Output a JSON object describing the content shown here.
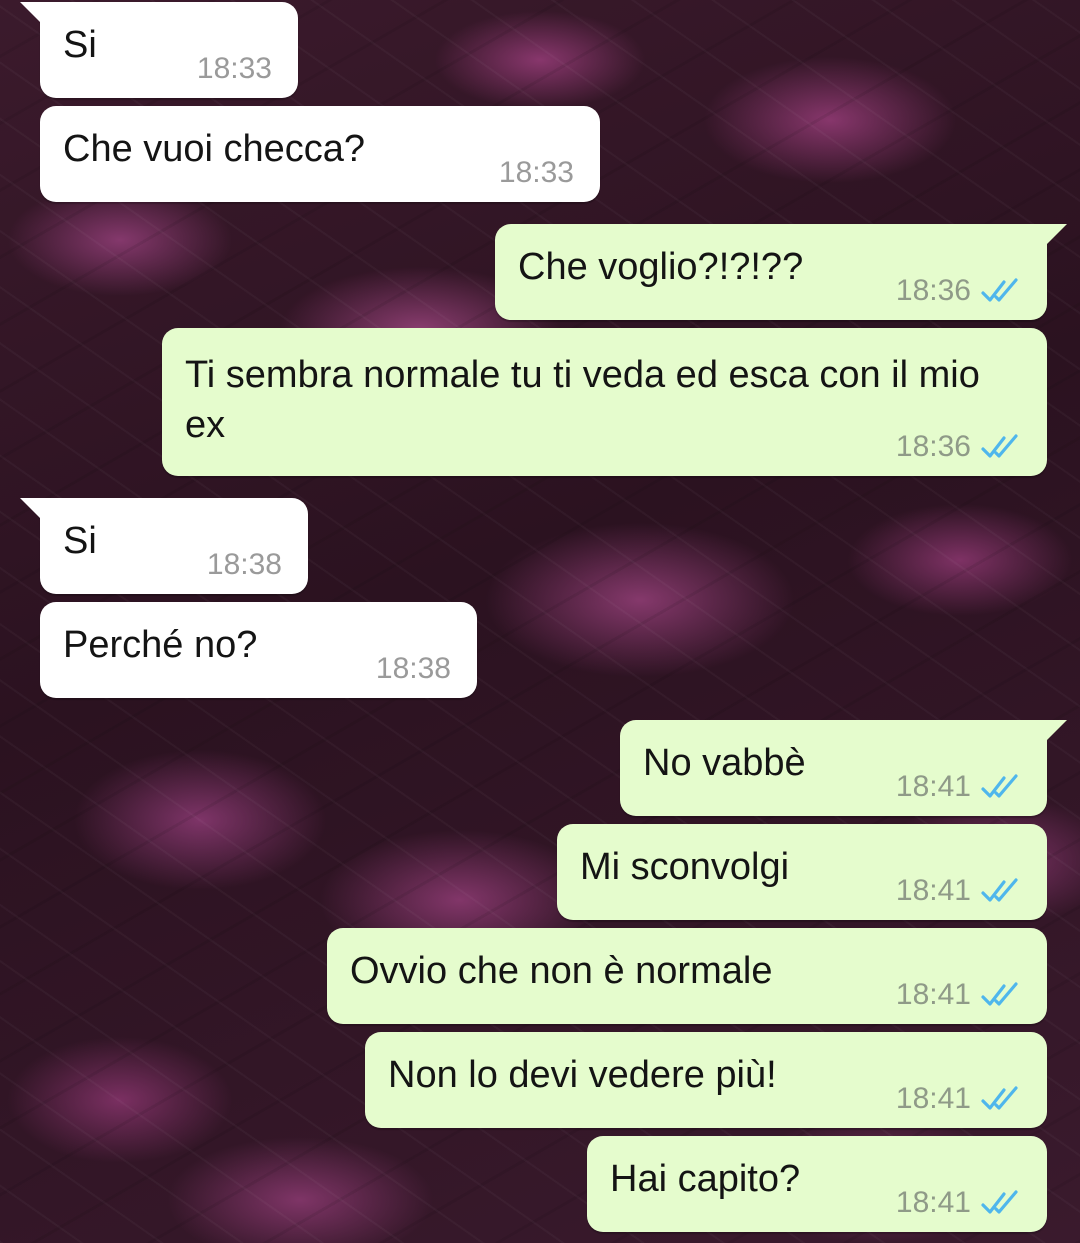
{
  "chat": {
    "messages": [
      {
        "direction": "in",
        "text": "Si",
        "time": "18:33"
      },
      {
        "direction": "in",
        "text": "Che vuoi checca?",
        "time": "18:33"
      },
      {
        "direction": "out",
        "text": "Che voglio?!?!??",
        "time": "18:36",
        "status": "read"
      },
      {
        "direction": "out",
        "text": "Ti sembra normale tu ti veda ed esca con il mio ex",
        "time": "18:36",
        "status": "read"
      },
      {
        "direction": "in",
        "text": "Si",
        "time": "18:38"
      },
      {
        "direction": "in",
        "text": "Perché no?",
        "time": "18:38"
      },
      {
        "direction": "out",
        "text": "No vabbè",
        "time": "18:41",
        "status": "read"
      },
      {
        "direction": "out",
        "text": "Mi sconvolgi",
        "time": "18:41",
        "status": "read"
      },
      {
        "direction": "out",
        "text": "Ovvio che non è normale",
        "time": "18:41",
        "status": "read"
      },
      {
        "direction": "out",
        "text": "Non lo devi vedere più!",
        "time": "18:41",
        "status": "read"
      },
      {
        "direction": "out",
        "text": "Hai capito?",
        "time": "18:41",
        "status": "read"
      }
    ]
  },
  "colors": {
    "incoming_bubble": "#ffffff",
    "outgoing_bubble": "#e5fccd",
    "read_ticks": "#4fb6ec"
  },
  "icons": {
    "read_status": "double-check-icon"
  }
}
